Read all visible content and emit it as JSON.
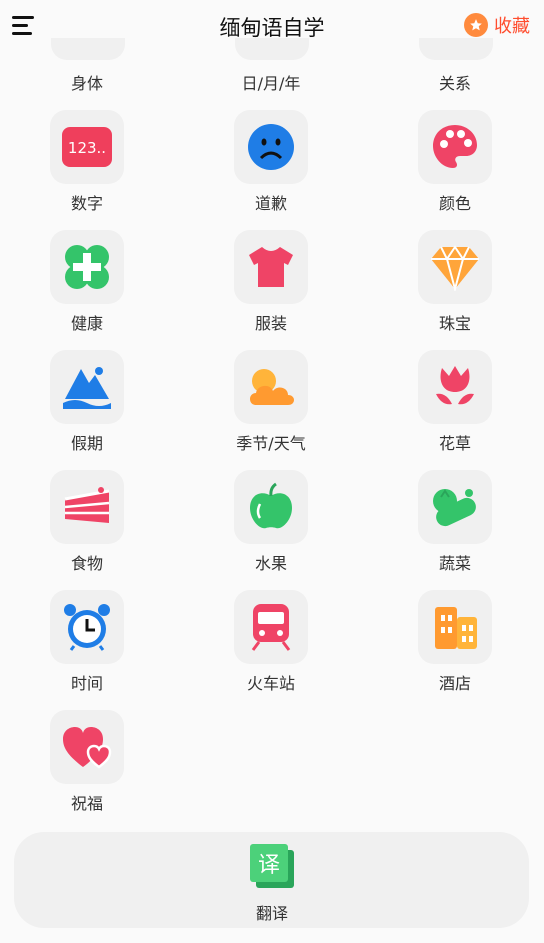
{
  "header": {
    "title": "缅甸语自学",
    "favorites_label": "收藏"
  },
  "top_row": [
    "身体",
    "日/月/年",
    "关系"
  ],
  "categories": [
    {
      "label": "数字",
      "icon": "number-badge-icon",
      "glyph": "123.."
    },
    {
      "label": "道歉",
      "icon": "sad-face-icon"
    },
    {
      "label": "颜色",
      "icon": "palette-icon"
    },
    {
      "label": "健康",
      "icon": "health-cross-icon"
    },
    {
      "label": "服装",
      "icon": "tshirt-icon"
    },
    {
      "label": "珠宝",
      "icon": "diamond-icon"
    },
    {
      "label": "假期",
      "icon": "mountain-icon"
    },
    {
      "label": "季节/天气",
      "icon": "cloud-sun-icon"
    },
    {
      "label": "花草",
      "icon": "flower-icon"
    },
    {
      "label": "食物",
      "icon": "cake-icon"
    },
    {
      "label": "水果",
      "icon": "apple-icon"
    },
    {
      "label": "蔬菜",
      "icon": "vegetables-icon"
    },
    {
      "label": "时间",
      "icon": "alarm-clock-icon"
    },
    {
      "label": "火车站",
      "icon": "train-icon"
    },
    {
      "label": "酒店",
      "icon": "hotel-building-icon"
    },
    {
      "label": "祝福",
      "icon": "hearts-icon"
    }
  ],
  "bottom_bar": {
    "translate_label": "翻译",
    "translate_glyph": "译"
  },
  "colors": {
    "accent": "#ff4d2e",
    "tile_bg": "#f0f0f0",
    "background": "#fafafa"
  }
}
